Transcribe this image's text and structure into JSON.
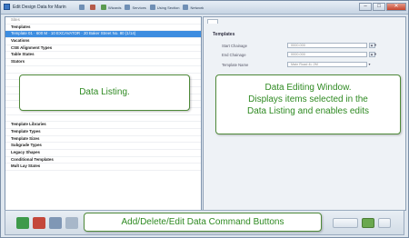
{
  "window": {
    "title": "Edit Design Data for Marin",
    "accent": "#3d8de0"
  },
  "toolbar": {
    "items": [
      {
        "label": "",
        "icon": "document-icon"
      },
      {
        "label": "",
        "icon": "cursor-icon"
      },
      {
        "label": "Wizards",
        "icon": "wand-icon"
      },
      {
        "label": "Services",
        "icon": "gear-icon"
      },
      {
        "label": "Using Section",
        "icon": "section-icon"
      },
      {
        "label": "Network",
        "icon": "network-icon"
      }
    ]
  },
  "window_controls": {
    "minimize": "–",
    "maximize": "□",
    "close": "✕"
  },
  "listing": {
    "rows": [
      {
        "text": "Sites",
        "style": "hdr"
      },
      {
        "text": "Templates",
        "style": "bold"
      },
      {
        "text": "Template 01 · 600 M · 10 EXCAVATOR · 20 Baker Street No. 80 (1/14)",
        "style": "sel"
      },
      {
        "text": "Vacations",
        "style": "bold"
      },
      {
        "text": "CSE Alignment Types",
        "style": "bold"
      },
      {
        "text": "Table States",
        "style": "bold"
      },
      {
        "text": "Stators",
        "style": "bold"
      },
      {
        "text": "",
        "style": ""
      },
      {
        "text": "",
        "style": ""
      },
      {
        "text": "",
        "style": ""
      },
      {
        "text": "",
        "style": ""
      },
      {
        "text": "",
        "style": ""
      },
      {
        "text": "",
        "style": ""
      },
      {
        "text": "",
        "style": ""
      },
      {
        "text": "",
        "style": ""
      },
      {
        "text": "Template Libraries",
        "style": "bold"
      },
      {
        "text": "Template Types",
        "style": "bold"
      },
      {
        "text": "Template Sizes",
        "style": "bold"
      },
      {
        "text": "Subgrade Types",
        "style": "bold"
      },
      {
        "text": "Legacy Shapes",
        "style": "bold"
      },
      {
        "text": "Conditional Templates",
        "style": "bold"
      },
      {
        "text": "Mult Lay States",
        "style": "bold"
      }
    ]
  },
  "editor": {
    "section": "Templates",
    "fields": [
      {
        "label": "Start Chainage",
        "value": "0000.000",
        "control": "stepper"
      },
      {
        "label": "End Chainage",
        "value": "0000.000",
        "control": "stepper"
      },
      {
        "label": "Template Name",
        "value": "Main Road 4L 2M",
        "control": "dropdown"
      }
    ],
    "stepper_glyph": "▲▼",
    "dropdown_glyph": "▾"
  },
  "callouts": {
    "listing": "Data Listing.",
    "editing": [
      "Data Editing Window.",
      "Displays items selected in the",
      "Data Listing and enables edits"
    ],
    "buttons": "Add/Delete/Edit Data Command Buttons"
  },
  "command_bar": {
    "right_labels": [
      "",
      "",
      ""
    ]
  }
}
